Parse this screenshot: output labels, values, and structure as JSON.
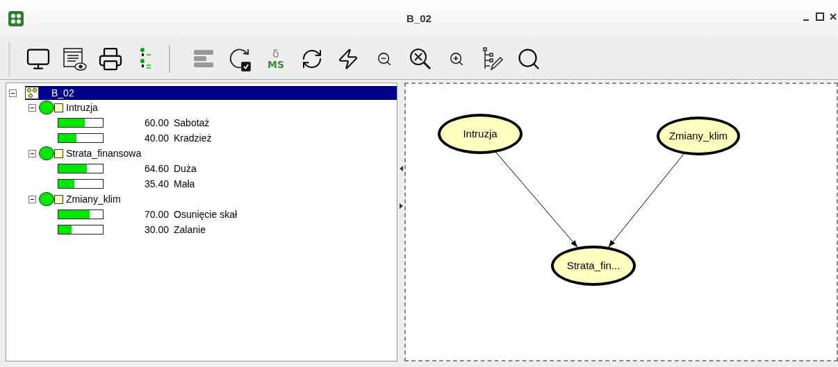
{
  "window": {
    "title": "B_02"
  },
  "toolbar": [
    {
      "kind": "monitor"
    },
    {
      "kind": "list-eye"
    },
    {
      "kind": "printer"
    },
    {
      "kind": "tree-nodes"
    },
    {
      "kind": "separator"
    },
    {
      "kind": "bars",
      "disabled": true
    },
    {
      "kind": "rotate-check"
    },
    {
      "kind": "delta-ms",
      "glyph": "δ",
      "label": "MS"
    },
    {
      "kind": "refresh"
    },
    {
      "kind": "zap"
    },
    {
      "kind": "zoom-out"
    },
    {
      "kind": "zoom-fit"
    },
    {
      "kind": "zoom-in"
    },
    {
      "kind": "tree-edit"
    },
    {
      "kind": "search"
    }
  ],
  "tree": {
    "label": "B_02",
    "selected": true,
    "expanded": true,
    "children": [
      {
        "label": "Intruzja",
        "expanded": true,
        "states": [
          {
            "value": "60.00",
            "name": "Sabotaż",
            "level": 0.6
          },
          {
            "value": "40.00",
            "name": "Kradzież",
            "level": 0.4
          }
        ]
      },
      {
        "label": "Strata_finansowa",
        "expanded": true,
        "states": [
          {
            "value": "64.60",
            "name": "Duża",
            "level": 0.646
          },
          {
            "value": "35.40",
            "name": "Mała",
            "level": 0.354
          }
        ]
      },
      {
        "label": "Zmiany_klim",
        "expanded": true,
        "states": [
          {
            "value": "70.00",
            "name": "Osunięcie skał",
            "level": 0.7
          },
          {
            "value": "30.00",
            "name": "Zalanie",
            "level": 0.3
          }
        ]
      }
    ]
  },
  "graph": {
    "nodes": [
      {
        "label": "Intruzja"
      },
      {
        "label": "Zmiany_klim"
      },
      {
        "label": "Strata_fin..."
      }
    ]
  }
}
